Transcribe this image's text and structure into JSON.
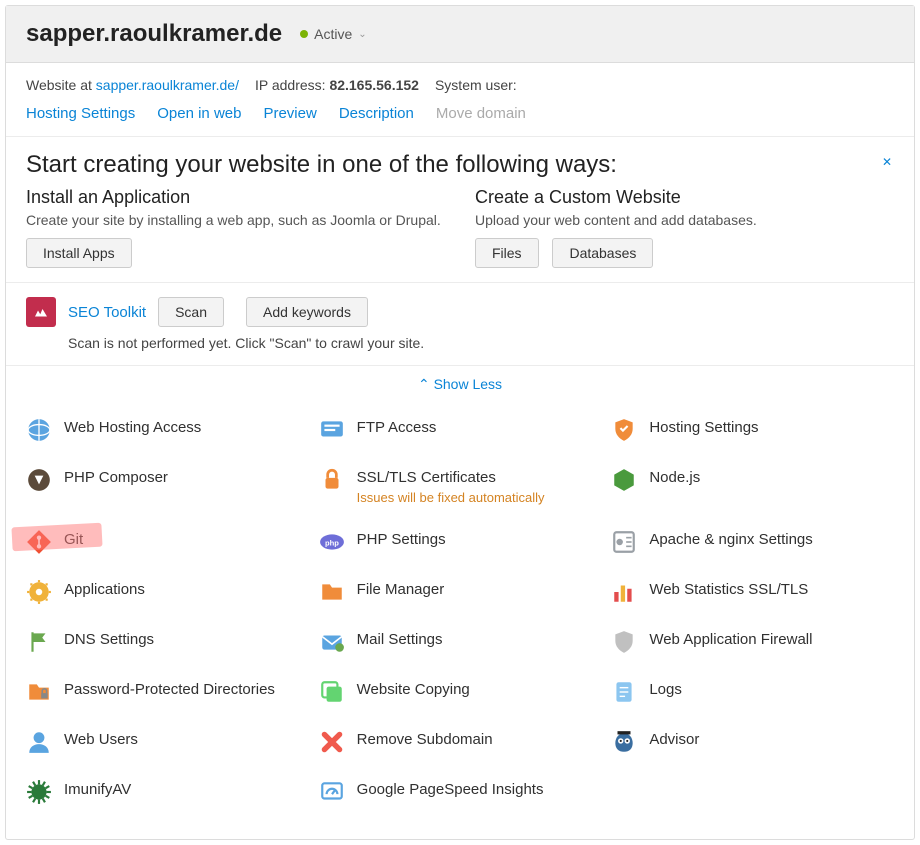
{
  "header": {
    "title": "sapper.raoulkramer.de",
    "status": "Active"
  },
  "meta": {
    "website_label": "Website at ",
    "website_url": "sapper.raoulkramer.de/",
    "ip_label": "IP address: ",
    "ip_value": "82.165.56.152",
    "system_user_label": "System user:"
  },
  "actions": {
    "hosting": "Hosting Settings",
    "open": "Open in web",
    "preview": "Preview",
    "description": "Description",
    "move": "Move domain"
  },
  "create": {
    "title": "Start creating your website in one of the following ways:",
    "install": {
      "heading": "Install an Application",
      "desc": "Create your site by installing a web app, such as Joomla or Drupal.",
      "btn": "Install Apps"
    },
    "custom": {
      "heading": "Create a Custom Website",
      "desc": "Upload your web content and add databases.",
      "files": "Files",
      "db": "Databases"
    }
  },
  "seo": {
    "title": "SEO Toolkit",
    "scan": "Scan",
    "add": "Add keywords",
    "note": "Scan is not performed yet. Click \"Scan\" to crawl your site."
  },
  "showless": "Show Less",
  "grid": [
    {
      "id": "web-hosting-access",
      "label": "Web Hosting Access",
      "icon": "globe",
      "c": "#5aa4e0"
    },
    {
      "id": "ftp-access",
      "label": "FTP Access",
      "icon": "ftp",
      "c": "#5aa4e0"
    },
    {
      "id": "hosting-settings",
      "label": "Hosting Settings",
      "icon": "shield",
      "c": "#f08c3a"
    },
    {
      "id": "php-composer",
      "label": "PHP Composer",
      "icon": "composer",
      "c": "#5b4a3a"
    },
    {
      "id": "ssl",
      "label": "SSL/TLS Certificates",
      "icon": "lock",
      "c": "#f08c3a",
      "note": "Issues will be fixed automatically"
    },
    {
      "id": "nodejs",
      "label": "Node.js",
      "icon": "hex",
      "c": "#4a9a3d"
    },
    {
      "id": "git",
      "label": "Git",
      "icon": "git",
      "c": "#f05033",
      "hl": true
    },
    {
      "id": "php-settings",
      "label": "PHP Settings",
      "icon": "php",
      "c": "#6e6ed8"
    },
    {
      "id": "apache-nginx",
      "label": "Apache & nginx Settings",
      "icon": "server",
      "c": "#9aa0a6"
    },
    {
      "id": "applications",
      "label": "Applications",
      "icon": "gear",
      "c": "#f0b23a"
    },
    {
      "id": "file-manager",
      "label": "File Manager",
      "icon": "folder",
      "c": "#f08c3a"
    },
    {
      "id": "web-stats",
      "label": "Web Statistics SSL/TLS",
      "icon": "stats",
      "c": "#e34d4d"
    },
    {
      "id": "dns-settings",
      "label": "DNS Settings",
      "icon": "flag",
      "c": "#6aa84f"
    },
    {
      "id": "mail-settings",
      "label": "Mail Settings",
      "icon": "mail",
      "c": "#5aa4e0"
    },
    {
      "id": "waf",
      "label": "Web Application Firewall",
      "icon": "shield2",
      "c": "#c0c0c0"
    },
    {
      "id": "pwd-dirs",
      "label": "Password-Protected Directories",
      "icon": "lockfolder",
      "c": "#f08c3a"
    },
    {
      "id": "website-copy",
      "label": "Website Copying",
      "icon": "copy",
      "c": "#63d471"
    },
    {
      "id": "logs",
      "label": "Logs",
      "icon": "logs",
      "c": "#8cc6f0"
    },
    {
      "id": "web-users",
      "label": "Web Users",
      "icon": "user",
      "c": "#5aa4e0"
    },
    {
      "id": "remove-sub",
      "label": "Remove Subdomain",
      "icon": "x",
      "c": "#f05a4d"
    },
    {
      "id": "advisor",
      "label": "Advisor",
      "icon": "owl",
      "c": "#3a6ea0"
    },
    {
      "id": "imunifyav",
      "label": "ImunifyAV",
      "icon": "spike",
      "c": "#2a7a3a"
    },
    {
      "id": "pagespeed",
      "label": "Google PageSpeed Insights",
      "icon": "speed",
      "c": "#5aa4e0"
    }
  ]
}
